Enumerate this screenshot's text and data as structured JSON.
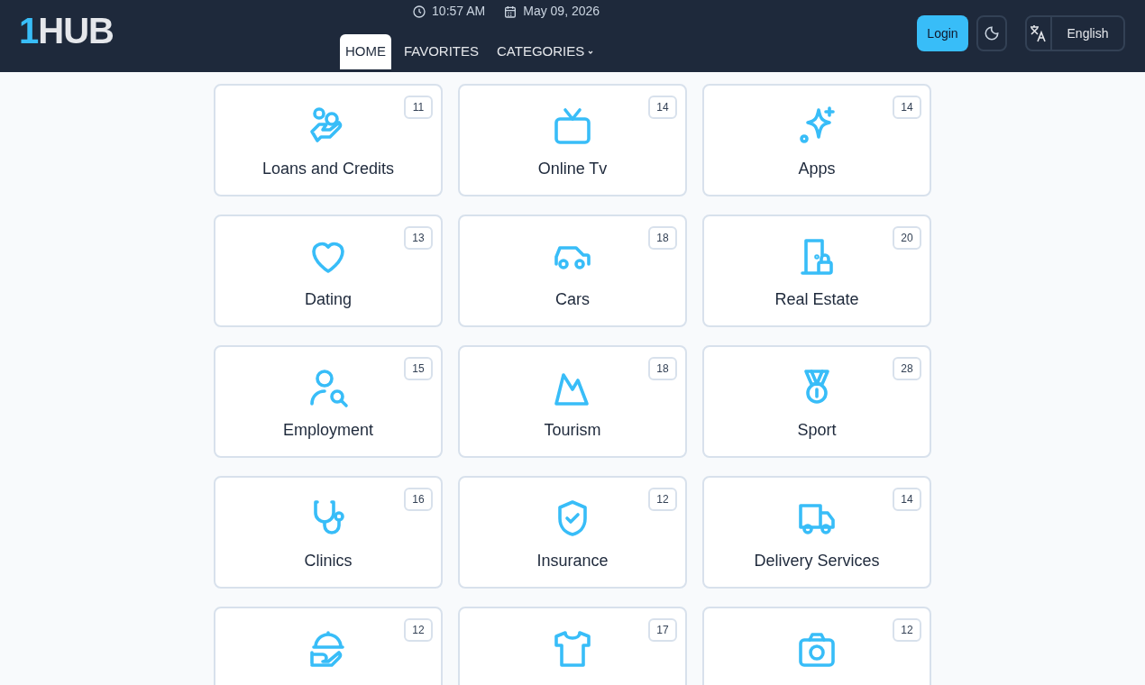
{
  "header": {
    "logo": {
      "accent": "1",
      "rest": "HUB"
    },
    "time": "10:57 AM",
    "date": "May 09, 2026",
    "nav": [
      {
        "label": "HOME",
        "selected": true,
        "dropdown": false
      },
      {
        "label": "FAVORITES",
        "selected": false,
        "dropdown": false
      },
      {
        "label": "CATEGORIES",
        "selected": false,
        "dropdown": true
      }
    ],
    "login": "Login",
    "language": "English"
  },
  "categories": [
    {
      "label": "Loans and Credits",
      "count": "11"
    },
    {
      "label": "Online Tv",
      "count": "14"
    },
    {
      "label": "Apps",
      "count": "14"
    },
    {
      "label": "Dating",
      "count": "13"
    },
    {
      "label": "Cars",
      "count": "18"
    },
    {
      "label": "Real Estate",
      "count": "20"
    },
    {
      "label": "Employment",
      "count": "15"
    },
    {
      "label": "Tourism",
      "count": "18"
    },
    {
      "label": "Sport",
      "count": "28"
    },
    {
      "label": "Clinics",
      "count": "16"
    },
    {
      "label": "Insurance",
      "count": "12"
    },
    {
      "label": "Delivery Services",
      "count": "14"
    },
    {
      "count": "12"
    },
    {
      "count": "17"
    },
    {
      "count": "12"
    }
  ]
}
